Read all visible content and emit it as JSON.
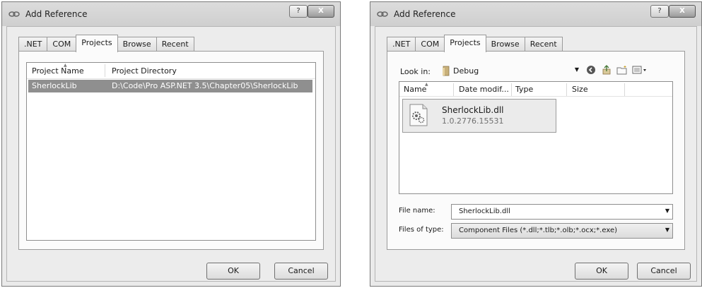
{
  "dialog1": {
    "title": "Add Reference",
    "help": "?",
    "close": "X",
    "tabs": [
      ".NET",
      "COM",
      "Projects",
      "Browse",
      "Recent"
    ],
    "columns": [
      "Project Name",
      "Project Directory"
    ],
    "rows": [
      {
        "name": "SherlockLib",
        "directory": "D:\\Code\\Pro ASP.NET 3.5\\Chapter05\\SherlockLib"
      }
    ],
    "ok": "OK",
    "cancel": "Cancel"
  },
  "dialog2": {
    "title": "Add Reference",
    "help": "?",
    "close": "X",
    "tabs": [
      ".NET",
      "COM",
      "Projects",
      "Browse",
      "Recent"
    ],
    "look_in_label": "Look in:",
    "look_in_value": "Debug",
    "columns": [
      "Name",
      "Date modif...",
      "Type",
      "Size"
    ],
    "file": {
      "name": "SherlockLib.dll",
      "version": "1.0.2776.15531"
    },
    "file_name_label": "File name:",
    "file_name_value": "SherlockLib.dll",
    "file_type_label": "Files of type:",
    "file_type_value": "Component Files (*.dll;*.tlb;*.olb;*.ocx;*.exe)",
    "ok": "OK",
    "cancel": "Cancel"
  }
}
